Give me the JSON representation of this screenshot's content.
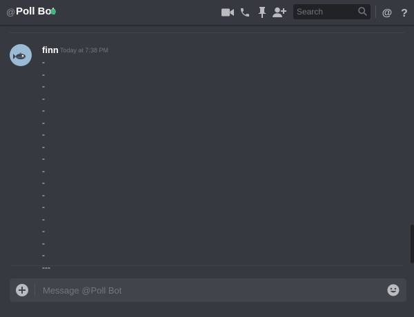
{
  "header": {
    "at_symbol": "@",
    "channel_name": "Poll Bot",
    "status": "online",
    "search_placeholder": "Search",
    "help_label": "?"
  },
  "icons": {
    "video": "video-camera-icon",
    "call": "phone-icon",
    "pinned": "pin-icon",
    "add_friend": "add-friend-icon",
    "search": "search-icon",
    "mentions": "at-sign-icon",
    "help": "question-mark-icon",
    "attach": "plus-circle-icon",
    "emoji": "smiley-face-icon"
  },
  "message": {
    "author": "finn",
    "timestamp": "Today at 7:38 PM",
    "lines": [
      "-",
      "-",
      "-",
      "-",
      "-",
      "-",
      "-",
      "-",
      "-",
      "-",
      "-",
      "-",
      "-",
      "-",
      "-",
      "-",
      "-",
      "---"
    ]
  },
  "composer": {
    "placeholder": "Message @Poll Bot"
  },
  "colors": {
    "background": "#36393f",
    "header_text": "#ffffff",
    "online": "#43b581",
    "input_bg": "#40444b",
    "search_bg": "#202225",
    "muted": "#72767d"
  }
}
